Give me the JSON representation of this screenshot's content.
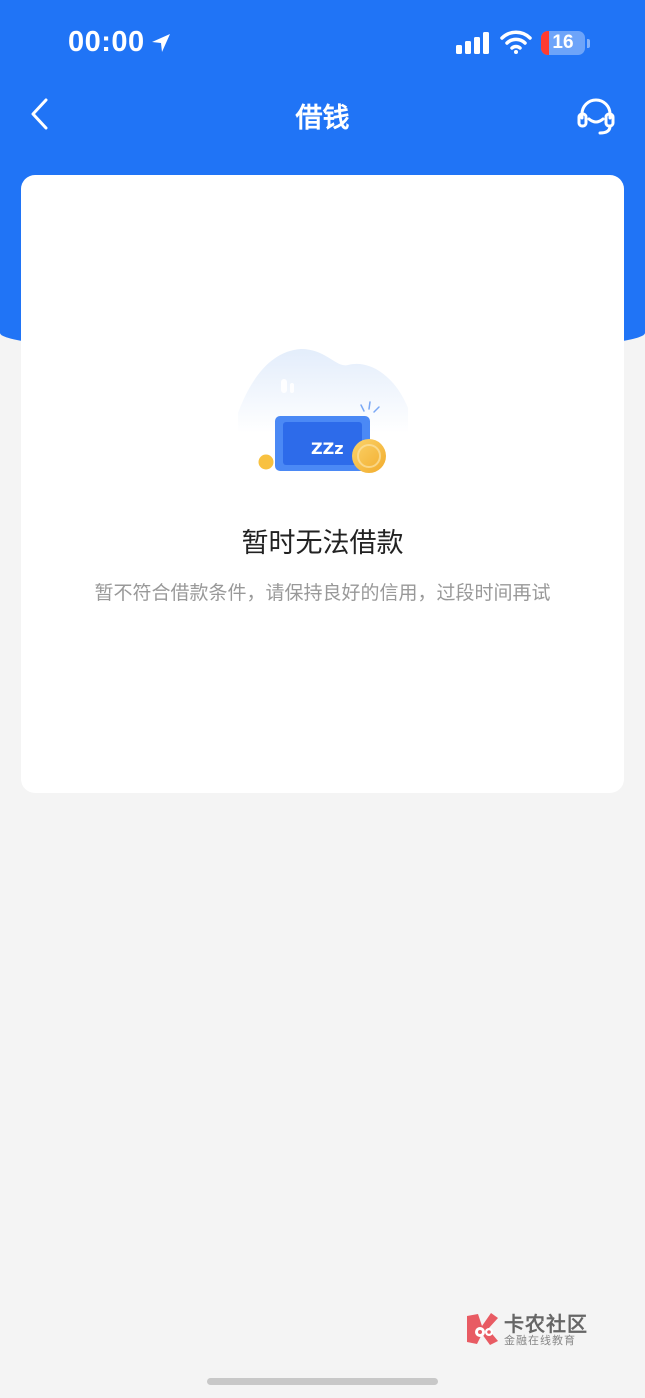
{
  "status_bar": {
    "time": "00:00",
    "battery_level": "16",
    "icons": [
      "location-arrow-icon",
      "signal-icon",
      "wifi-icon",
      "battery-icon"
    ]
  },
  "nav": {
    "title": "借钱",
    "back_icon": "chevron-left-icon",
    "support_icon": "customer-service-headset-icon"
  },
  "empty_state": {
    "illustration": "sleeping-phone-coin-illustration",
    "illustration_text": "ZZz",
    "title": "暂时无法借款",
    "description": "暂不符合借款条件，请保持良好的信用，过段时间再试"
  },
  "watermark": {
    "title": "卡农社区",
    "subtitle": "金融在线教育"
  },
  "colors": {
    "primary": "#2074f6",
    "background": "#f4f4f4",
    "card": "#ffffff",
    "title_text": "#222222",
    "desc_text": "#999999",
    "coin": "#f8c140"
  }
}
